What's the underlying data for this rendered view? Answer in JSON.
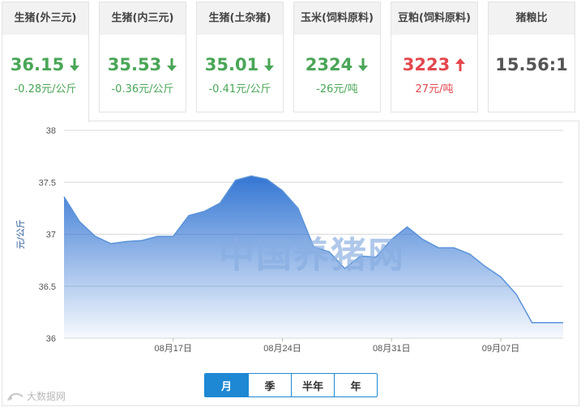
{
  "cards": [
    {
      "title": "生猪(外三元)",
      "value": "36.15",
      "change": "-0.28元/公斤",
      "trend": "down"
    },
    {
      "title": "生猪(内三元)",
      "value": "35.53",
      "change": "-0.36元/公斤",
      "trend": "down"
    },
    {
      "title": "生猪(土杂猪)",
      "value": "35.01",
      "change": "-0.41元/公斤",
      "trend": "down"
    },
    {
      "title": "玉米(饲料原料)",
      "value": "2324",
      "change": "-26元/吨",
      "trend": "down"
    },
    {
      "title": "豆粕(饲料原料)",
      "value": "3223",
      "change": "27元/吨",
      "trend": "up"
    },
    {
      "title": "猪粮比",
      "value": "15.56:1",
      "change": "",
      "trend": "neutral"
    }
  ],
  "colors": {
    "down": "#4aa657",
    "up": "#e4474e",
    "accent": "#1e88d4",
    "line": "#5b93d9"
  },
  "watermark": "中国养猪网",
  "periods": [
    "月",
    "季",
    "半年",
    "年"
  ],
  "selected_period": "月",
  "source": "大数据网",
  "chart_data": {
    "type": "area",
    "title": "",
    "xlabel": "",
    "ylabel": "元/公斤",
    "ylim": [
      36,
      38
    ],
    "yticks": [
      "38",
      "37.5",
      "37",
      "36.5",
      "36"
    ],
    "xlim": [
      "2024-08-10",
      "2024-09-11"
    ],
    "xticks": [
      {
        "label": "08月17日",
        "date": "2024-08-17"
      },
      {
        "label": "08月24日",
        "date": "2024-08-24"
      },
      {
        "label": "08月31日",
        "date": "2024-08-31"
      },
      {
        "label": "09月07日",
        "date": "2024-09-07"
      }
    ],
    "grid": true,
    "series": [
      {
        "x": [
          "2024-08-10",
          "2024-08-11",
          "2024-08-12",
          "2024-08-13",
          "2024-08-14",
          "2024-08-15",
          "2024-08-16",
          "2024-08-17",
          "2024-08-18",
          "2024-08-19",
          "2024-08-20",
          "2024-08-21",
          "2024-08-22",
          "2024-08-23",
          "2024-08-24",
          "2024-08-25",
          "2024-08-26",
          "2024-08-27",
          "2024-08-28",
          "2024-08-29",
          "2024-08-30",
          "2024-08-31",
          "2024-09-01",
          "2024-09-02",
          "2024-09-03",
          "2024-09-04",
          "2024-09-05",
          "2024-09-06",
          "2024-09-07",
          "2024-09-08",
          "2024-09-09",
          "2024-09-10",
          "2024-09-11"
        ],
        "values": [
          37.36,
          37.12,
          36.98,
          36.91,
          36.93,
          36.94,
          36.98,
          36.98,
          37.18,
          37.22,
          37.3,
          37.52,
          37.56,
          37.53,
          37.42,
          37.25,
          36.88,
          36.83,
          36.67,
          36.79,
          36.78,
          36.95,
          37.07,
          36.95,
          36.87,
          36.87,
          36.81,
          36.69,
          36.59,
          36.42,
          36.15,
          36.15,
          36.15
        ]
      }
    ]
  }
}
